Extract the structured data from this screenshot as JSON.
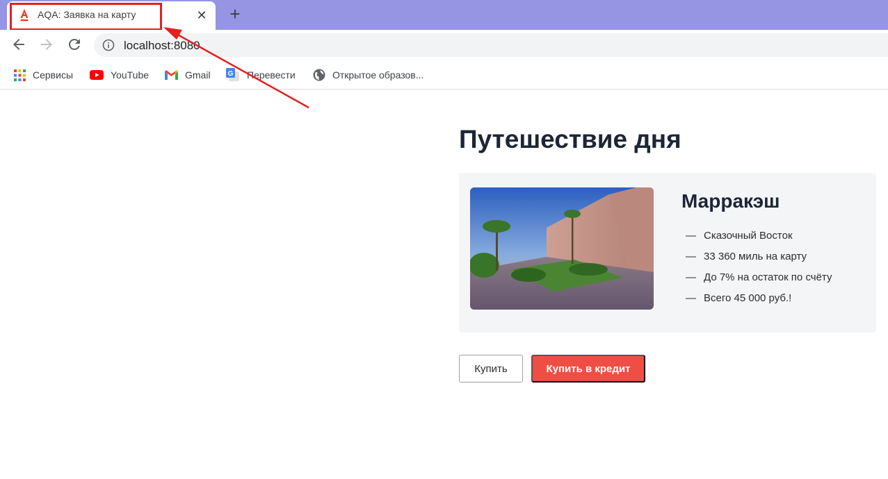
{
  "browser": {
    "tab": {
      "title": "AQA: Заявка на карту",
      "favicon": "alfa-bank-icon",
      "close_glyph": "✕"
    },
    "new_tab_glyph": "+",
    "address": "localhost:8080",
    "bookmarks": [
      {
        "label": "Сервисы",
        "icon": "apps-grid-icon"
      },
      {
        "label": "YouTube",
        "icon": "youtube-icon"
      },
      {
        "label": "Gmail",
        "icon": "gmail-icon"
      },
      {
        "label": "Перевести",
        "icon": "google-translate-icon"
      },
      {
        "label": "Открытое образов...",
        "icon": "globe-icon"
      }
    ]
  },
  "page": {
    "title": "Путешествие дня",
    "card": {
      "city": "Марракэш",
      "dash": "—",
      "features": [
        "Сказочный Восток",
        "33 360 миль на карту",
        "До 7% на остаток по счёту",
        "Всего 45 000 руб.!"
      ]
    },
    "buttons": {
      "buy": "Купить",
      "buy_credit": "Купить в кредит"
    }
  },
  "colors": {
    "tabstrip": "#9595e3",
    "annotation": "#e41f1f",
    "credit_button": "#ef4e44",
    "title_text": "#1d2636"
  }
}
